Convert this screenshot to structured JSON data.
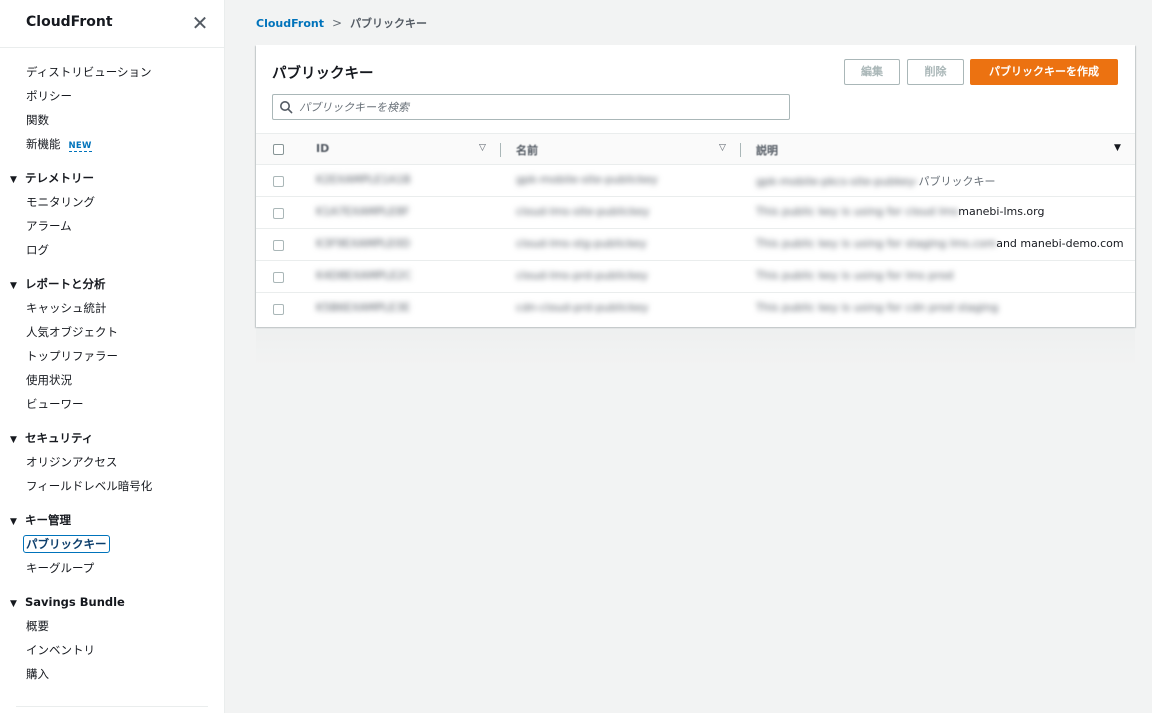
{
  "sidebar": {
    "title": "CloudFront",
    "close_glyph": "✕",
    "top_items": [
      {
        "label": "ディストリビューション"
      },
      {
        "label": "ポリシー"
      },
      {
        "label": "関数"
      },
      {
        "label": "新機能",
        "badge": "NEW"
      }
    ],
    "sections": [
      {
        "label": "テレメトリー",
        "items": [
          "モニタリング",
          "アラーム",
          "ログ"
        ]
      },
      {
        "label": "レポートと分析",
        "items": [
          "キャッシュ統計",
          "人気オブジェクト",
          "トップリファラー",
          "使用状況",
          "ビューワー"
        ]
      },
      {
        "label": "セキュリティ",
        "items": [
          "オリジンアクセス",
          "フィールドレベル暗号化"
        ]
      },
      {
        "label": "キー管理",
        "items": [
          "パブリックキー",
          "キーグループ"
        ]
      },
      {
        "label": "Savings Bundle",
        "items": [
          "概要",
          "インベントリ",
          "購入"
        ]
      }
    ]
  },
  "breadcrumb": {
    "root": "CloudFront",
    "current": "パブリックキー"
  },
  "panel": {
    "title": "パブリックキー",
    "edit_label": "編集",
    "delete_label": "削除",
    "create_label": "パブリックキーを作成",
    "search_placeholder": "パブリックキーを検索"
  },
  "table": {
    "columns": [
      "ID",
      "名前",
      "説明"
    ],
    "rows": [
      {
        "id": "K2EXAMPLE1A1B",
        "name": "gpk-mobile-site-publickey",
        "desc_hidden": "gpk-mobile-pkcs-site-pubkey-",
        "desc_visible": "パブリックキー"
      },
      {
        "id": "K1A7EXAMPLE8F",
        "name": "cloud-lms-site-publickey",
        "desc_hidden": "This public key is using for cloud lms ",
        "desc_visible": "manebi-lms.org"
      },
      {
        "id": "K3F9EXAMPLE0D",
        "name": "cloud-lms-stg-publickey",
        "desc_hidden": "This public key is using for staging lms.com ",
        "desc_visible": "and manebi-demo.com"
      },
      {
        "id": "K4D8EXAMPLE2C",
        "name": "cloud-lms-prd-publickey",
        "desc_hidden": "This public key is using for lms prod",
        "desc_visible": ""
      },
      {
        "id": "K5B6EXAMPLE3E",
        "name": "cdn-cloud-prd-publickey",
        "desc_hidden": "This public key is using for cdn prod staging",
        "desc_visible": ""
      }
    ]
  },
  "colors": {
    "accent": "#ec7211",
    "link": "#0073bb"
  }
}
